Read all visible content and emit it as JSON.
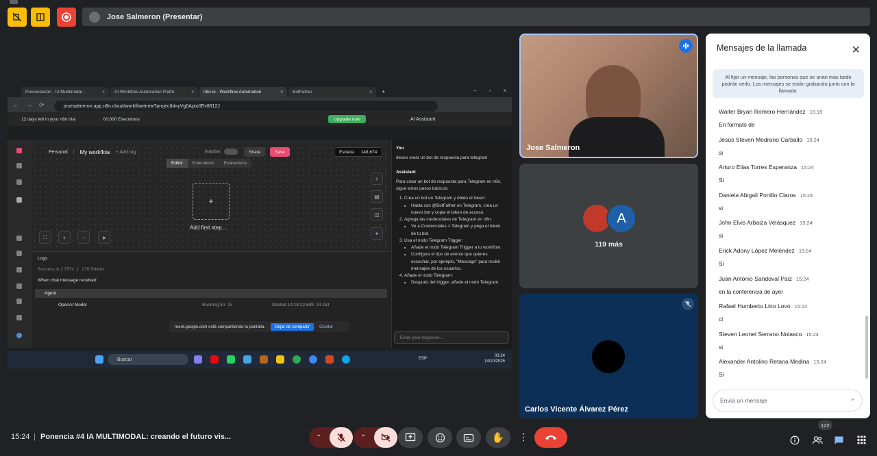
{
  "presenter_bar": {
    "label": "Jose Salmeron (Presentar)"
  },
  "browser": {
    "tabs": [
      "Presentación - IA Multimodal -",
      "AI Workflow Automation Platfo",
      "n8n.io - Workflow Automation",
      "BotFather"
    ],
    "url": "josesalmeron.app.n8n.cloud/workflow/new?projectId=yVg0Apto0Ev8812J"
  },
  "n8n": {
    "trial": "12 days left in your n8n trial",
    "executions": "0/1000 Executions",
    "upgrade": "Upgrade now",
    "ai_assistant": "AI Assistant",
    "personal": "Personal",
    "workflow_name": "My workflow",
    "add_tag": "+ Add tag",
    "inactive": "Inactivo",
    "share": "Share",
    "save": "Save",
    "star": "Estrella",
    "star_count": "148,674",
    "tabs": [
      "Editor",
      "Executions",
      "Evaluations"
    ],
    "add_first_step": "Add first step...",
    "logs": "Logs",
    "success": "Success in 2.757s",
    "tokens": "276 Tokens",
    "when_chat": "When chat message received",
    "agent": "Agent",
    "openai_model": "OpenAI Model",
    "running": "Running for -3s",
    "started": "Started 14:18:22.689, 14 Oct"
  },
  "assistant_chat": {
    "you": "You",
    "user_msg": "deseo crear un bot de respuesta para telegram",
    "assistant": "Assistant",
    "intro": "Para crear un bot de respuesta para Telegram en n8n, sigue estos pasos básicos:",
    "step1": "Crea un bot en Telegram y obtén el token:",
    "step1a": "Habla con @BotFather en Telegram, crea un nuevo bot y copia el token de acceso.",
    "step2": "Agrega las credenciales de Telegram en n8n:",
    "step2a": "Ve a Credenciales > Telegram y pega el token de tu bot.",
    "step3": "Usa el nodo Telegram Trigger:",
    "step3a": "Añade el nodo Telegram Trigger a tu workflow.",
    "step3b": "Configura el tipo de evento que quieres escuchar, por ejemplo, \"Message\" para recibir mensajes de los usuarios.",
    "step4": "Añade el nodo Telegram:",
    "step4a": "Después del trigger, añade el nodo Telegram.",
    "input_placeholder": "Enter your response..."
  },
  "share_banner": {
    "text": "meet.google.com está compartiendo tu pantalla.",
    "stop": "Dejar de compartir",
    "hide": "Ocultar"
  },
  "taskbar": {
    "search": "Buscar",
    "lang": "ESP",
    "time": "03:24",
    "date": "14/10/2025"
  },
  "tiles": {
    "jose": "Jose Salmeron",
    "more_initial": "A",
    "more_count": "119 más",
    "carlos": "Carlos Vicente Álvarez Pérez"
  },
  "chat_panel": {
    "title": "Mensajes de la llamada",
    "pin_note": "Al fijar un mensaje, las personas que se unan más tarde podrán verlo. Los mensajes se están grabando junto con la llamada.",
    "messages": [
      {
        "who": "Walter Bryan Romero Hernández",
        "time": "15:19",
        "text": "En formato de"
      },
      {
        "who": "Jesús Steven Medrano Carballo",
        "time": "15:24",
        "text": "si"
      },
      {
        "who": "Arturo Elias Torres Esperanza",
        "time": "15:24",
        "text": "Si"
      },
      {
        "who": "Daniela Abigail Portillo Claros",
        "time": "15:24",
        "text": "si"
      },
      {
        "who": "John Elvis Arbaiza Velásquez",
        "time": "15:24",
        "text": "si"
      },
      {
        "who": "Erick Adony López Meléndez",
        "time": "15:24",
        "text": "Si"
      },
      {
        "who": "Juan Antonio Sandoval Paiz",
        "time": "15:24",
        "text": "en la conferencia de ayer"
      },
      {
        "who": "Rafael Humberto Lino Lovo",
        "time": "15:24",
        "text": "ci"
      },
      {
        "who": "Steven Leonel Serrano Nolasco",
        "time": "15:24",
        "text": "si"
      },
      {
        "who": "Alexander Antolino Retana Medina",
        "time": "15:24",
        "text": "Sí"
      }
    ],
    "input_placeholder": "Envía un mensaje"
  },
  "bottom": {
    "time": "15:24",
    "separator": "|",
    "meeting": "Ponencia #4 IA MULTIMODAL: creando el futuro vis...",
    "participants": "122"
  }
}
